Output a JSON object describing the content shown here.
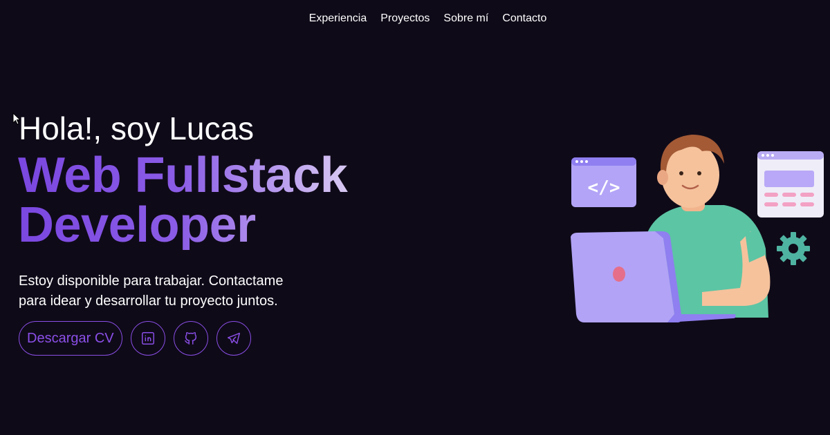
{
  "nav": {
    "items": [
      {
        "label": "Experiencia"
      },
      {
        "label": "Proyectos"
      },
      {
        "label": "Sobre mí"
      },
      {
        "label": "Contacto"
      }
    ]
  },
  "hero": {
    "greeting": "Hola!, soy Lucas",
    "title": "Web Fullstack Developer",
    "description": "Estoy disponible para trabajar. Contactame para idear y desarrollar tu proyecto juntos."
  },
  "actions": {
    "cv_label": "Descargar CV",
    "icons": [
      "linkedin-icon",
      "github-icon",
      "telegram-icon"
    ]
  },
  "illustration": {
    "code_window_text": "</>"
  },
  "colors": {
    "background": "#0f0a18",
    "accent": "#8a4fe8",
    "title_gradient_start": "#7a47e0",
    "title_gradient_end": "#e6dcf5"
  }
}
